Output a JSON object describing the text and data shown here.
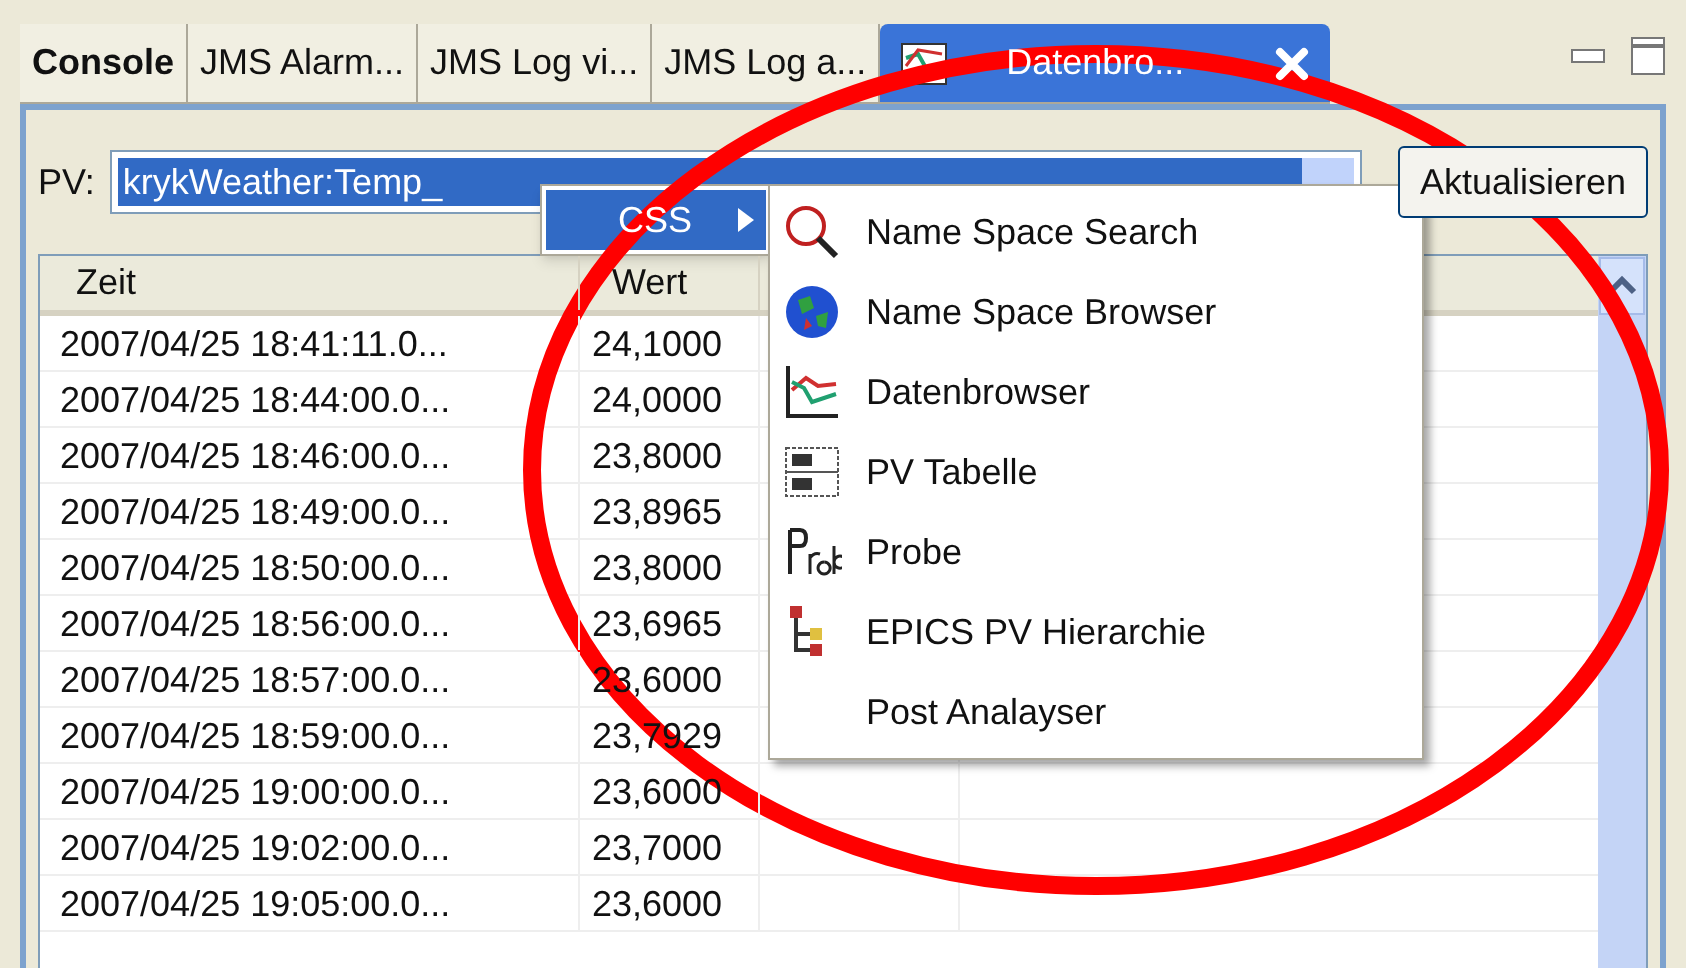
{
  "tabs": [
    {
      "label": "Console",
      "selected": false,
      "bold": true
    },
    {
      "label": "JMS Alarm...",
      "selected": false,
      "bold": false
    },
    {
      "label": "JMS Log vi...",
      "selected": false,
      "bold": false
    },
    {
      "label": "JMS Log a...",
      "selected": false,
      "bold": false
    },
    {
      "label": "Datenbro...",
      "selected": true,
      "bold": false
    }
  ],
  "pv": {
    "label": "PV:",
    "value": "krykWeather:Temp_"
  },
  "refresh_button": "Aktualisieren",
  "table": {
    "columns": [
      "Zeit",
      "Wert"
    ],
    "rows": [
      {
        "zeit": "2007/04/25 18:41:11.0...",
        "wert": "24,1000"
      },
      {
        "zeit": "2007/04/25 18:44:00.0...",
        "wert": "24,0000"
      },
      {
        "zeit": "2007/04/25 18:46:00.0...",
        "wert": "23,8000"
      },
      {
        "zeit": "2007/04/25 18:49:00.0...",
        "wert": "23,8965"
      },
      {
        "zeit": "2007/04/25 18:50:00.0...",
        "wert": "23,8000"
      },
      {
        "zeit": "2007/04/25 18:56:00.0...",
        "wert": "23,6965"
      },
      {
        "zeit": "2007/04/25 18:57:00.0...",
        "wert": "23,6000"
      },
      {
        "zeit": "2007/04/25 18:59:00.0...",
        "wert": "23,7929"
      },
      {
        "zeit": "2007/04/25 19:00:00.0...",
        "wert": "23,6000"
      },
      {
        "zeit": "2007/04/25 19:02:00.0...",
        "wert": "23,7000"
      },
      {
        "zeit": "2007/04/25 19:05:00.0...",
        "wert": "23,6000"
      }
    ]
  },
  "context_menu": {
    "items": [
      {
        "label": "CSS",
        "selected": true
      }
    ]
  },
  "submenu": {
    "items": [
      {
        "label": "Name Space Search",
        "kind": "search"
      },
      {
        "label": "Name Space Browser",
        "kind": "globe"
      },
      {
        "label": "Datenbrowser",
        "kind": "chart"
      },
      {
        "label": "PV Tabelle",
        "kind": "table"
      },
      {
        "label": "Probe",
        "kind": "probe"
      },
      {
        "label": "EPICS PV Hierarchie",
        "kind": "tree"
      },
      {
        "label": "Post Analayser",
        "kind": "none"
      }
    ]
  }
}
